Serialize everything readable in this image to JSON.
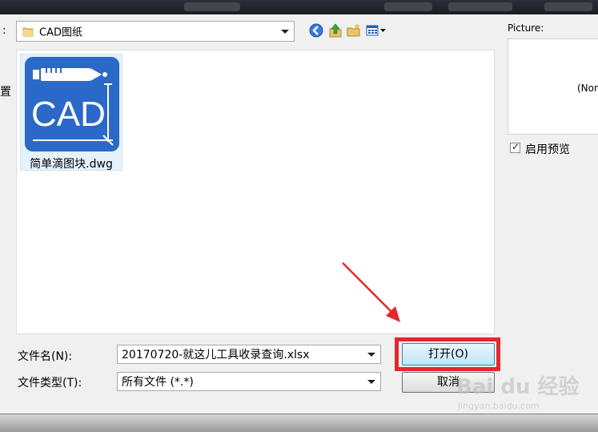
{
  "dialog": {
    "lookin_colon": ":",
    "side_char": "置",
    "lookin_folder": "CAD图纸",
    "picture_label": "Picture:",
    "picture_none": "(None)",
    "preview_label": "启用预览",
    "preview_checked": true,
    "filename_label": "文件名(N):",
    "filename_value": "20170720-就这儿工具收录查询.xlsx",
    "filetype_label": "文件类型(T):",
    "filetype_value": "所有文件 (*.*)",
    "open_button": "打开(O)",
    "cancel_button": "取消"
  },
  "files": [
    {
      "name": "简单滴图块.dwg",
      "icon": "cad-file-icon",
      "icon_text": "CAD"
    }
  ],
  "toolbar_icons": [
    "back-icon",
    "up-folder-icon",
    "new-folder-icon",
    "view-menu-icon"
  ],
  "watermark": {
    "text": "Bai du 经验",
    "sub": "jingyan.baidu.com"
  },
  "colors": {
    "highlight": "#e8262b",
    "cad_blue": "#2b69c8",
    "selection": "#e5f1fb"
  }
}
